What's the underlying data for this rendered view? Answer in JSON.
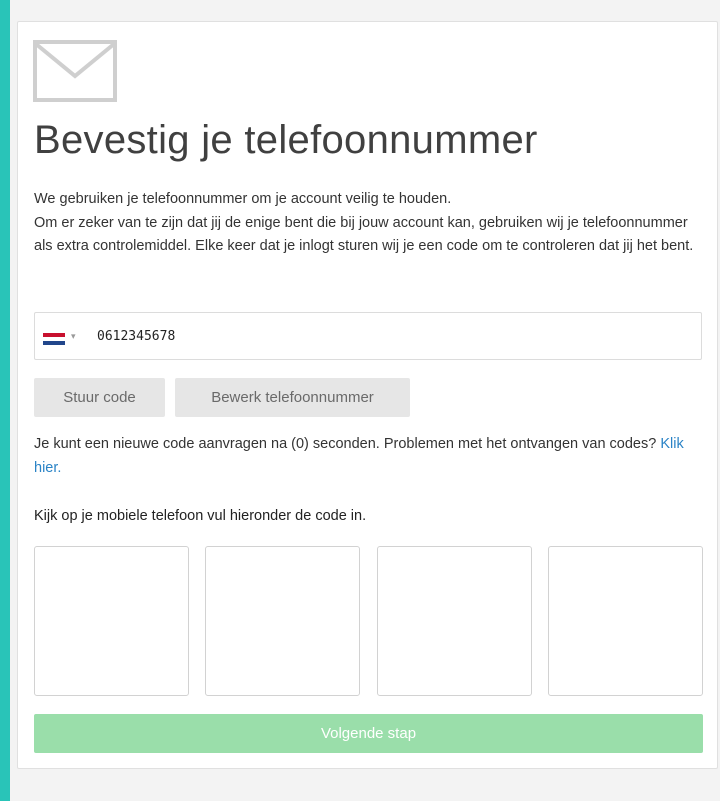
{
  "title": "Bevestig je telefoonnummer",
  "intro": {
    "line1": "We gebruiken je telefoonnummer om je account veilig te houden.",
    "line2": "Om er zeker van te zijn dat jij de enige bent die bij jouw account kan, gebruiken wij je telefoonnummer als extra controlemiddel. Elke keer dat je inlogt sturen wij je een code om te controleren dat jij het bent."
  },
  "phone": {
    "country_icon": "netherlands-flag-icon",
    "value": "0612345678"
  },
  "buttons": {
    "send_code": "Stuur code",
    "edit_phone": "Bewerk telefoonnummer",
    "next_step": "Volgende stap"
  },
  "info": {
    "text": "Je kunt een nieuwe code aanvragen na (0) seconden. Problemen met het ontvangen van codes?",
    "link": "Klik hier."
  },
  "instruction": "Kijk op je mobiele telefoon vul hieronder de code in.",
  "code_boxes": [
    "",
    "",
    "",
    ""
  ],
  "colors": {
    "accent_background": "#29c4b8",
    "next_button": "#9adeaa",
    "link": "#2a83c6"
  }
}
